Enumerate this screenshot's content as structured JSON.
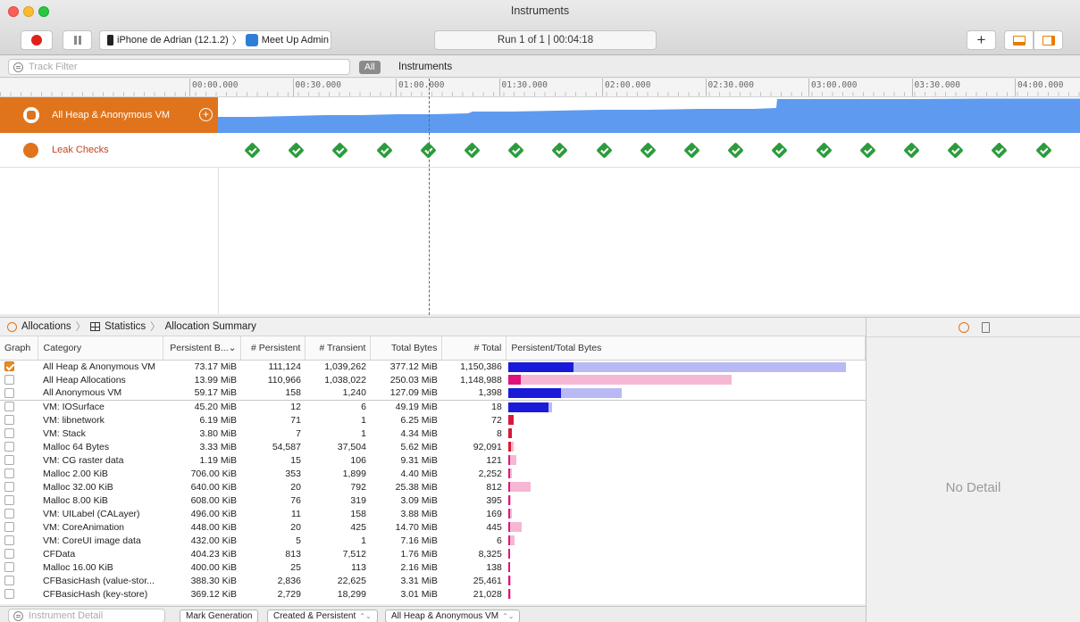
{
  "window": {
    "title": "Instruments",
    "target_device": "iPhone de Adrian (12.1.2)",
    "target_separator": "〉",
    "target_app": "Meet Up Admin",
    "run_status": "Run 1 of 1  |  00:04:18",
    "add_label": "+"
  },
  "filter_bar": {
    "track_filter_placeholder": "Track Filter",
    "all_chip": "All",
    "instruments_label": "Instruments"
  },
  "timeline": {
    "ticks": [
      "00:00.000",
      "00:30.000",
      "01:00.000",
      "01:30.000",
      "02:00.000",
      "02:30.000",
      "03:00.000",
      "03:30.000",
      "04:00.000"
    ],
    "tracks": [
      {
        "name": "All Heap & Anonymous VM",
        "color": "#e0741c"
      },
      {
        "name": "Leak Checks",
        "color": "#c4441a"
      }
    ],
    "heap_color": "#5e9bf0",
    "leak_check_count": 19
  },
  "breadcrumbs": {
    "allocations": "Allocations",
    "statistics": "Statistics",
    "summary": "Allocation Summary",
    "separator": "〉"
  },
  "table": {
    "columns": [
      "Graph",
      "Category",
      "Persistent B...",
      "# Persistent",
      "# Transient",
      "Total Bytes",
      "# Total",
      "Persistent/Total Bytes"
    ],
    "sort_indicator": "⌄",
    "rows": [
      {
        "checked": true,
        "category": "All Heap & Anonymous VM",
        "persistent_bytes": "73.17 MiB",
        "persistent": "111,124",
        "transient": "1,039,262",
        "total_bytes": "377.12 MiB",
        "total": "1,150,386",
        "persist_frac": 0.194,
        "total_frac": 1.0,
        "scheme": "blue"
      },
      {
        "checked": false,
        "category": "All Heap Allocations",
        "persistent_bytes": "13.99 MiB",
        "persistent": "110,966",
        "transient": "1,038,022",
        "total_bytes": "250.03 MiB",
        "total": "1,148,988",
        "persist_frac": 0.037,
        "total_frac": 0.663,
        "scheme": "pink"
      },
      {
        "checked": false,
        "category": "All Anonymous VM",
        "persistent_bytes": "59.17 MiB",
        "persistent": "158",
        "transient": "1,240",
        "total_bytes": "127.09 MiB",
        "total": "1,398",
        "persist_frac": 0.157,
        "total_frac": 0.337,
        "scheme": "blue",
        "group_end": true
      },
      {
        "checked": false,
        "category": "VM: IOSurface",
        "persistent_bytes": "45.20 MiB",
        "persistent": "12",
        "transient": "6",
        "total_bytes": "49.19 MiB",
        "total": "18",
        "persist_frac": 0.12,
        "total_frac": 0.13,
        "scheme": "blue"
      },
      {
        "checked": false,
        "category": "VM: libnetwork",
        "persistent_bytes": "6.19 MiB",
        "persistent": "71",
        "transient": "1",
        "total_bytes": "6.25 MiB",
        "total": "72",
        "persist_frac": 0.016,
        "total_frac": 0.017,
        "scheme": "red"
      },
      {
        "checked": false,
        "category": "VM: Stack",
        "persistent_bytes": "3.80 MiB",
        "persistent": "7",
        "transient": "1",
        "total_bytes": "4.34 MiB",
        "total": "8",
        "persist_frac": 0.01,
        "total_frac": 0.012,
        "scheme": "red"
      },
      {
        "checked": false,
        "category": "Malloc 64 Bytes",
        "persistent_bytes": "3.33 MiB",
        "persistent": "54,587",
        "transient": "37,504",
        "total_bytes": "5.62 MiB",
        "total": "92,091",
        "persist_frac": 0.009,
        "total_frac": 0.015,
        "scheme": "red"
      },
      {
        "checked": false,
        "category": "VM: CG raster data",
        "persistent_bytes": "1.19 MiB",
        "persistent": "15",
        "transient": "106",
        "total_bytes": "9.31 MiB",
        "total": "121",
        "persist_frac": 0.003,
        "total_frac": 0.025,
        "scheme": "pink"
      },
      {
        "checked": false,
        "category": "Malloc 2.00 KiB",
        "persistent_bytes": "706.00 KiB",
        "persistent": "353",
        "transient": "1,899",
        "total_bytes": "4.40 MiB",
        "total": "2,252",
        "persist_frac": 0.002,
        "total_frac": 0.012,
        "scheme": "pink"
      },
      {
        "checked": false,
        "category": "Malloc 32.00 KiB",
        "persistent_bytes": "640.00 KiB",
        "persistent": "20",
        "transient": "792",
        "total_bytes": "25.38 MiB",
        "total": "812",
        "persist_frac": 0.002,
        "total_frac": 0.067,
        "scheme": "pink"
      },
      {
        "checked": false,
        "category": "Malloc 8.00 KiB",
        "persistent_bytes": "608.00 KiB",
        "persistent": "76",
        "transient": "319",
        "total_bytes": "3.09 MiB",
        "total": "395",
        "persist_frac": 0.002,
        "total_frac": 0.008,
        "scheme": "pink"
      },
      {
        "checked": false,
        "category": "VM: UILabel (CALayer)",
        "persistent_bytes": "496.00 KiB",
        "persistent": "11",
        "transient": "158",
        "total_bytes": "3.88 MiB",
        "total": "169",
        "persist_frac": 0.001,
        "total_frac": 0.01,
        "scheme": "pink"
      },
      {
        "checked": false,
        "category": "VM: CoreAnimation",
        "persistent_bytes": "448.00 KiB",
        "persistent": "20",
        "transient": "425",
        "total_bytes": "14.70 MiB",
        "total": "445",
        "persist_frac": 0.001,
        "total_frac": 0.039,
        "scheme": "pink"
      },
      {
        "checked": false,
        "category": "VM: CoreUI image data",
        "persistent_bytes": "432.00 KiB",
        "persistent": "5",
        "transient": "1",
        "total_bytes": "7.16 MiB",
        "total": "6",
        "persist_frac": 0.001,
        "total_frac": 0.019,
        "scheme": "pink"
      },
      {
        "checked": false,
        "category": "CFData",
        "persistent_bytes": "404.23 KiB",
        "persistent": "813",
        "transient": "7,512",
        "total_bytes": "1.76 MiB",
        "total": "8,325",
        "persist_frac": 0.001,
        "total_frac": 0.005,
        "scheme": "pink"
      },
      {
        "checked": false,
        "category": "Malloc 16.00 KiB",
        "persistent_bytes": "400.00 KiB",
        "persistent": "25",
        "transient": "113",
        "total_bytes": "2.16 MiB",
        "total": "138",
        "persist_frac": 0.001,
        "total_frac": 0.006,
        "scheme": "pink"
      },
      {
        "checked": false,
        "category": "CFBasicHash (value-stor...",
        "persistent_bytes": "388.30 KiB",
        "persistent": "2,836",
        "transient": "22,625",
        "total_bytes": "3.31 MiB",
        "total": "25,461",
        "persist_frac": 0.001,
        "total_frac": 0.009,
        "scheme": "pink"
      },
      {
        "checked": false,
        "category": "CFBasicHash (key-store)",
        "persistent_bytes": "369.12 KiB",
        "persistent": "2,729",
        "transient": "18,299",
        "total_bytes": "3.01 MiB",
        "total": "21,028",
        "persist_frac": 0.001,
        "total_frac": 0.008,
        "scheme": "pink"
      }
    ]
  },
  "bottom_bar": {
    "detail_placeholder": "Instrument Detail",
    "mark_generation": "Mark Generation",
    "lifespan": "Created & Persistent",
    "allocation_type": "All Heap & Anonymous VM",
    "updown": "⌃⌄"
  },
  "detail": {
    "empty_text": "No Detail"
  },
  "colors": {
    "blue_persist": "#1a1ad9",
    "blue_total": "#b9baf5",
    "pink_persist": "#e0127a",
    "pink_total": "#f5b7d3",
    "red_persist": "#d9183a",
    "red_total": "#f7b8c4"
  }
}
